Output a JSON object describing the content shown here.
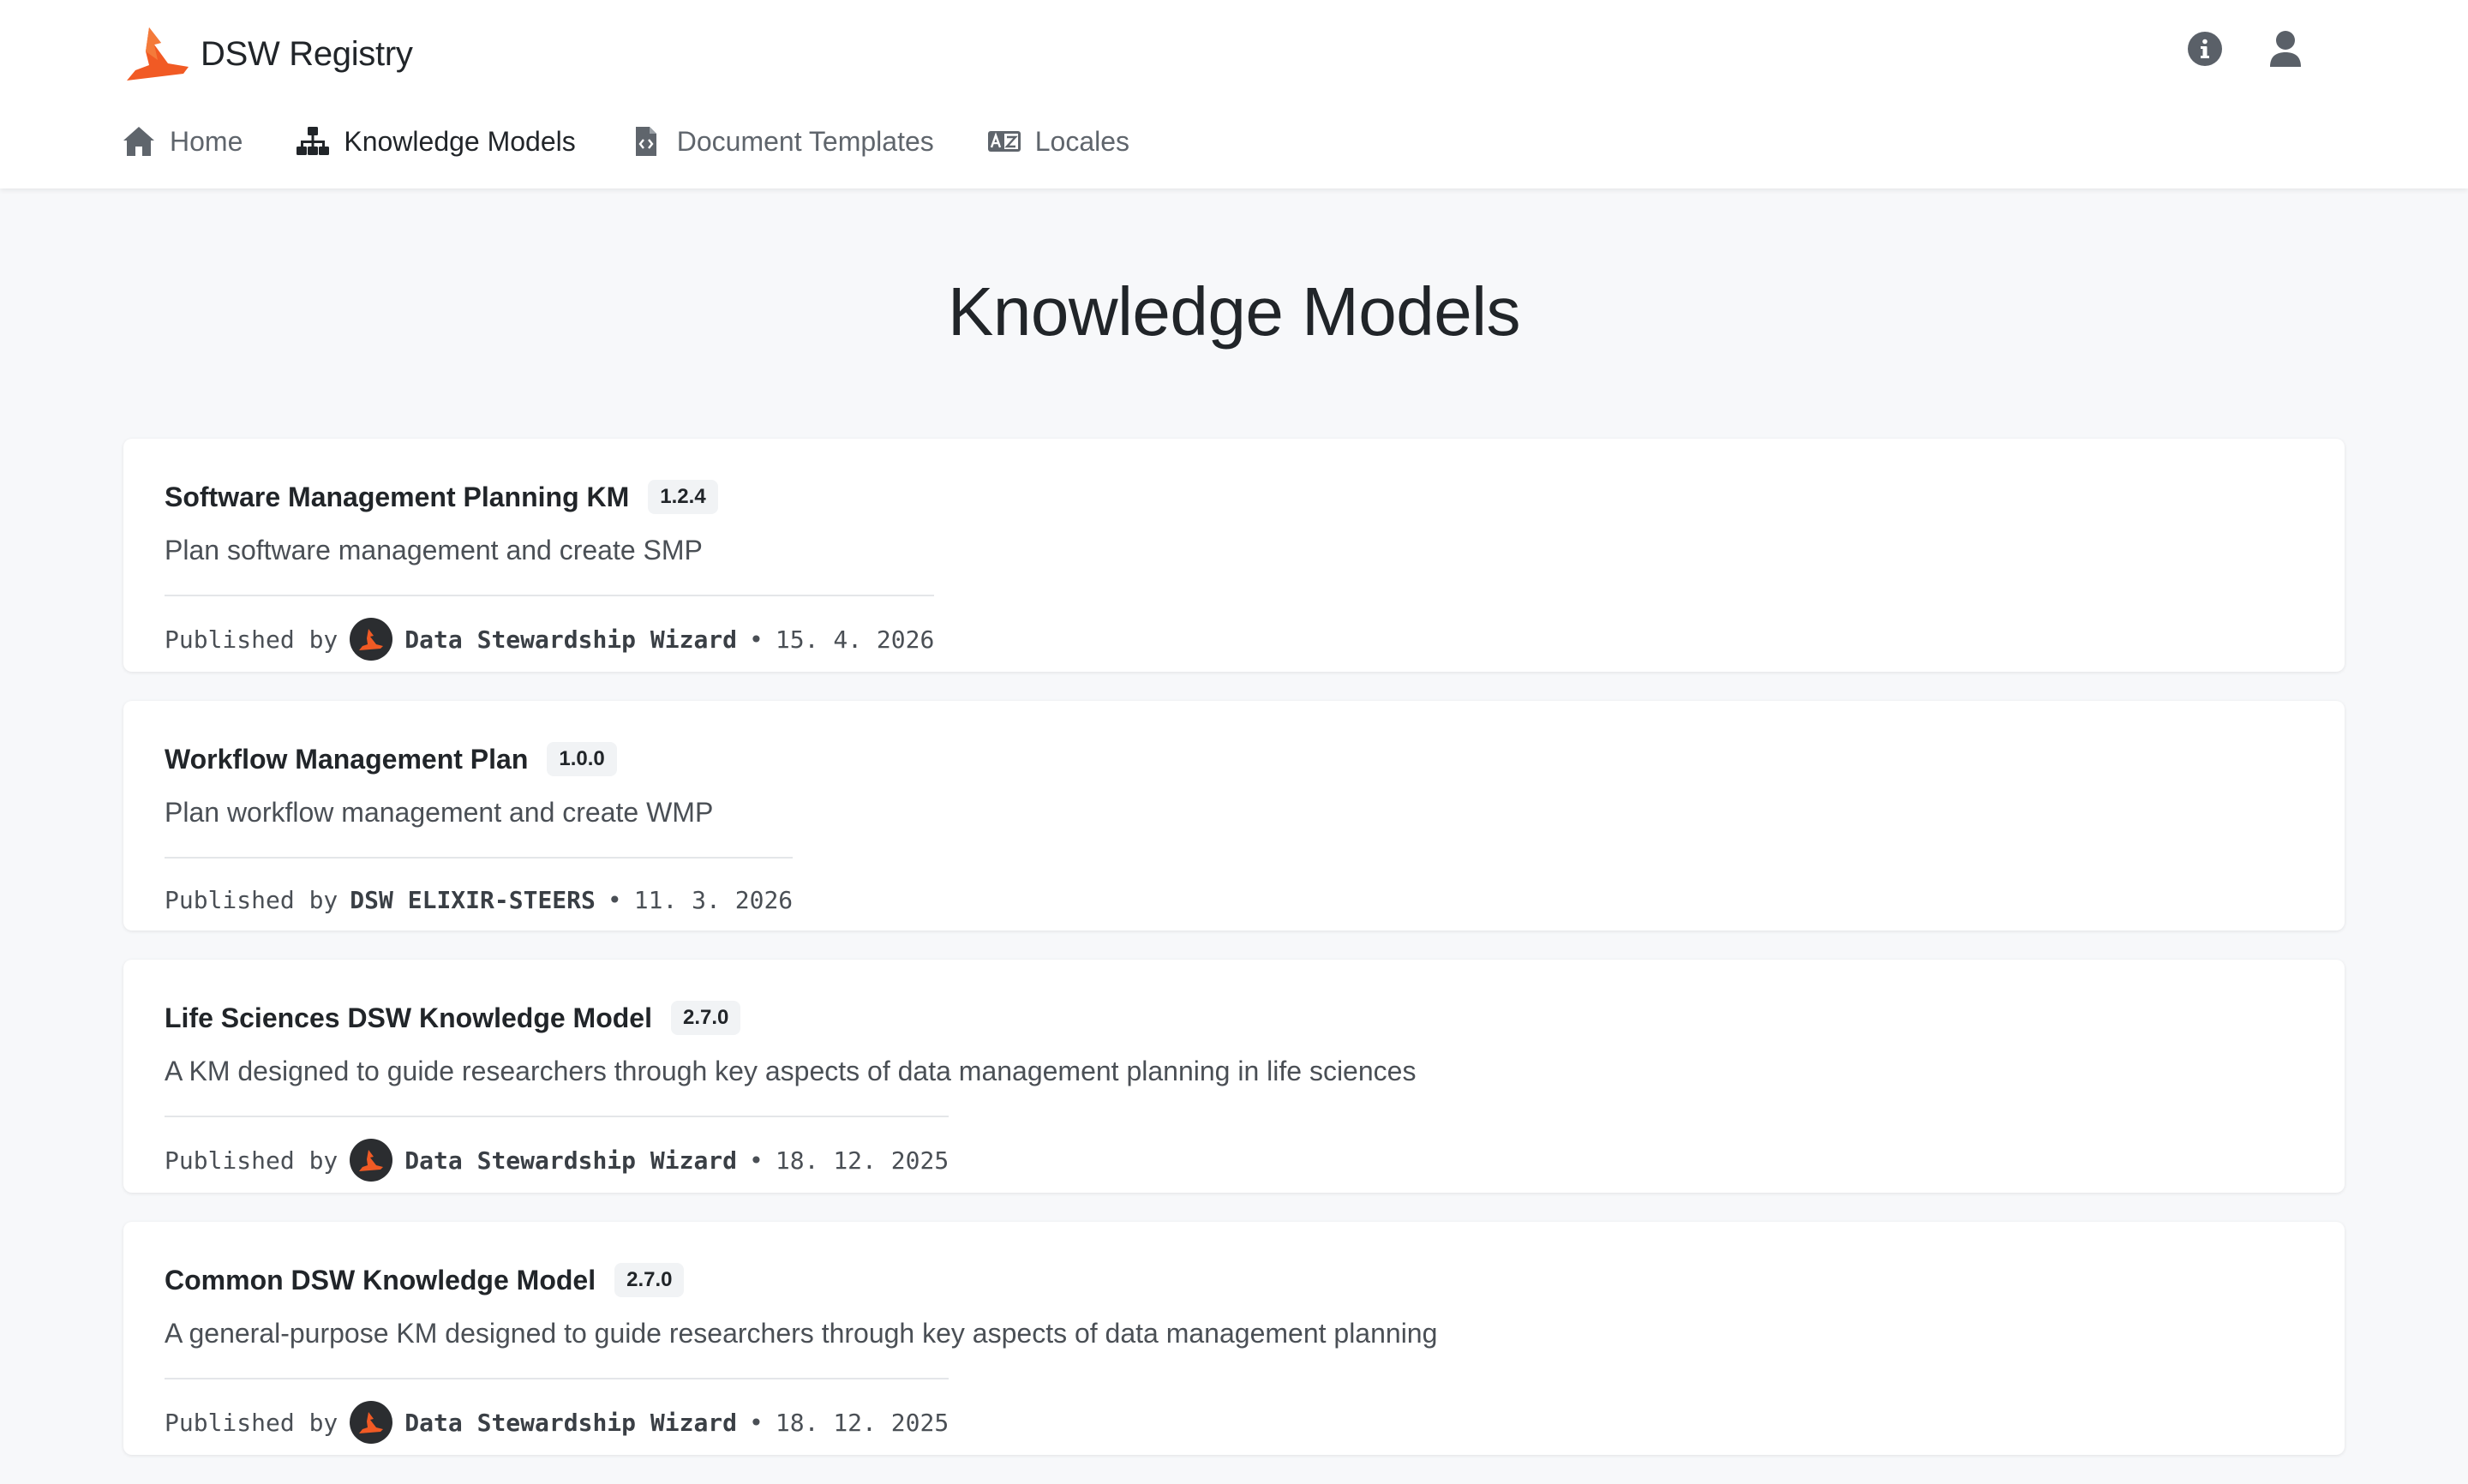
{
  "brand": {
    "name": "DSW Registry",
    "accent": "#f15a24"
  },
  "header": {
    "icons": [
      "info-icon",
      "user-icon"
    ]
  },
  "nav": {
    "items": [
      {
        "label": "Home",
        "icon": "home-icon",
        "active": false
      },
      {
        "label": "Knowledge Models",
        "icon": "sitemap-icon",
        "active": true
      },
      {
        "label": "Document Templates",
        "icon": "file-code-icon",
        "active": false
      },
      {
        "label": "Locales",
        "icon": "language-icon",
        "active": false
      }
    ]
  },
  "page": {
    "title": "Knowledge Models"
  },
  "models": [
    {
      "title": "Software Management Planning KM",
      "version": "1.2.4",
      "description": "Plan software management and create SMP",
      "published_by_label": "Published by",
      "organization": "Data Stewardship Wizard",
      "has_avatar": true,
      "separator": "•",
      "date": "15. 4. 2026"
    },
    {
      "title": "Workflow Management Plan",
      "version": "1.0.0",
      "description": "Plan workflow management and create WMP",
      "published_by_label": "Published by",
      "organization": "DSW ELIXIR-STEERS",
      "has_avatar": false,
      "separator": "•",
      "date": "11. 3. 2026"
    },
    {
      "title": "Life Sciences DSW Knowledge Model",
      "version": "2.7.0",
      "description": "A KM designed to guide researchers through key aspects of data management planning in life sciences",
      "published_by_label": "Published by",
      "organization": "Data Stewardship Wizard",
      "has_avatar": true,
      "separator": "•",
      "date": "18. 12. 2025"
    },
    {
      "title": "Common DSW Knowledge Model",
      "version": "2.7.0",
      "description": "A general-purpose KM designed to guide researchers through key aspects of data management planning",
      "published_by_label": "Published by",
      "organization": "Data Stewardship Wizard",
      "has_avatar": true,
      "separator": "•",
      "date": "18. 12. 2025"
    }
  ]
}
